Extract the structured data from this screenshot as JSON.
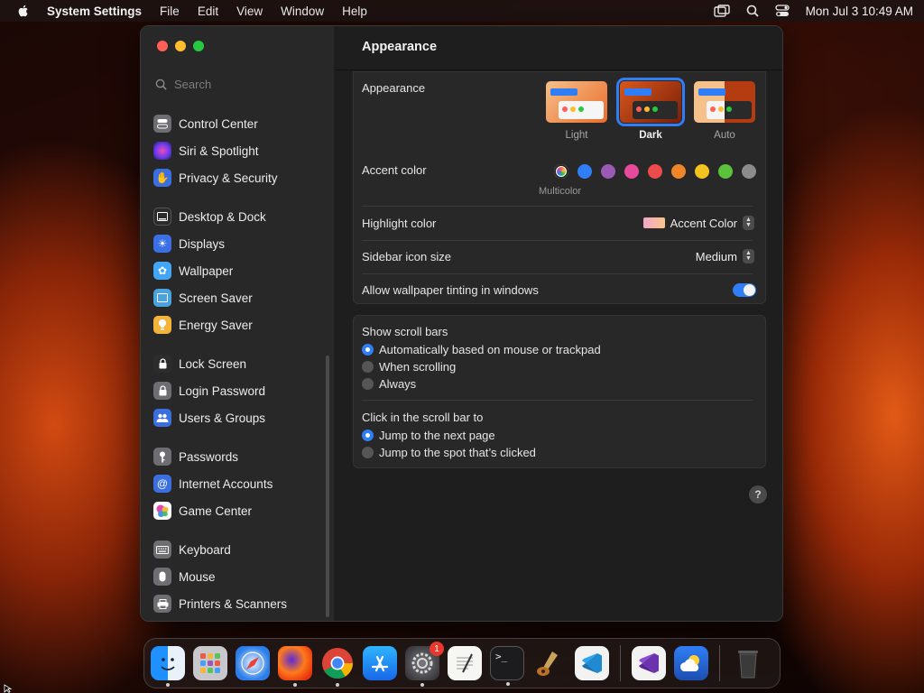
{
  "menubar": {
    "app_name": "System Settings",
    "items": [
      "File",
      "Edit",
      "View",
      "Window",
      "Help"
    ],
    "clock": "Mon Jul 3  10:49 AM"
  },
  "sidebar": {
    "search_placeholder": "Search",
    "items": [
      {
        "label": "Control Center",
        "icon": "control-center-icon",
        "color": "#6d6d72"
      },
      {
        "label": "Siri & Spotlight",
        "icon": "siri-icon",
        "color": "#3a3a8c"
      },
      {
        "label": "Privacy & Security",
        "icon": "hand-icon",
        "color": "#3b6fe0"
      },
      {
        "label": "Desktop & Dock",
        "icon": "desktop-icon",
        "color": "#2c2c2c"
      },
      {
        "label": "Displays",
        "icon": "sun-icon",
        "color": "#3a6fe6"
      },
      {
        "label": "Wallpaper",
        "icon": "flower-icon",
        "color": "#42a5f5"
      },
      {
        "label": "Screen Saver",
        "icon": "screen-saver-icon",
        "color": "#4aa3df"
      },
      {
        "label": "Energy Saver",
        "icon": "bulb-icon",
        "color": "#f4b33b"
      },
      {
        "label": "Lock Screen",
        "icon": "lock-icon",
        "color": "#2c2c2c"
      },
      {
        "label": "Login Password",
        "icon": "padlock-icon",
        "color": "#6d6d72"
      },
      {
        "label": "Users & Groups",
        "icon": "users-icon",
        "color": "#3b6fe0"
      },
      {
        "label": "Passwords",
        "icon": "key-icon",
        "color": "#6d6d72"
      },
      {
        "label": "Internet Accounts",
        "icon": "at-icon",
        "color": "#3b6fe0"
      },
      {
        "label": "Game Center",
        "icon": "game-center-icon",
        "color": "#ffffff"
      },
      {
        "label": "Keyboard",
        "icon": "keyboard-icon",
        "color": "#6d6d72"
      },
      {
        "label": "Mouse",
        "icon": "mouse-icon",
        "color": "#6d6d72"
      },
      {
        "label": "Printers & Scanners",
        "icon": "printer-icon",
        "color": "#6d6d72"
      }
    ]
  },
  "main": {
    "title": "Appearance",
    "appearance": {
      "label": "Appearance",
      "options": [
        "Light",
        "Dark",
        "Auto"
      ],
      "selected": "Dark"
    },
    "accent": {
      "label": "Accent color",
      "selected_label": "Multicolor",
      "colors": [
        "#2f7ef6",
        "#9b59b6",
        "#e84a9b",
        "#eb4b4b",
        "#f0862a",
        "#f4c11f",
        "#5ac33b",
        "#8c8c8c"
      ]
    },
    "highlight": {
      "label": "Highlight color",
      "value": "Accent Color"
    },
    "sidebar_icon_size": {
      "label": "Sidebar icon size",
      "value": "Medium"
    },
    "tinting": {
      "label": "Allow wallpaper tinting in windows",
      "enabled": true
    },
    "scroll_bars": {
      "label": "Show scroll bars",
      "options": [
        "Automatically based on mouse or trackpad",
        "When scrolling",
        "Always"
      ],
      "selected": 0
    },
    "click_scroll": {
      "label": "Click in the scroll bar to",
      "options": [
        "Jump to the next page",
        "Jump to the spot that’s clicked"
      ],
      "selected": 0
    },
    "help": "?"
  },
  "dock": {
    "items": [
      "Finder",
      "Launchpad",
      "Safari",
      "Firefox",
      "Chrome",
      "App Store",
      "System Settings",
      "TextEdit",
      "Terminal",
      "Instruments",
      "Visual Studio Code",
      "Visual Studio",
      "Weather",
      "Trash"
    ],
    "settings_badge": "1"
  }
}
